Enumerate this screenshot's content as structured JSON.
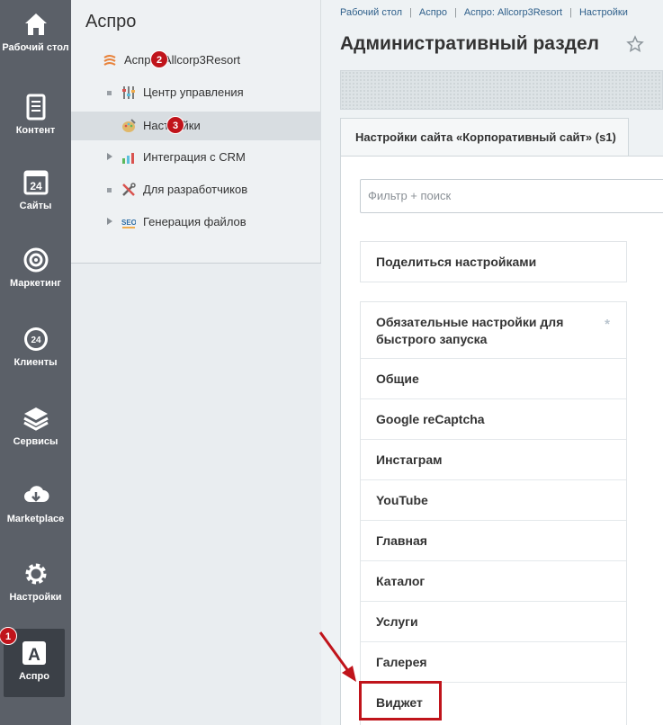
{
  "rail": {
    "items": [
      {
        "label": "Рабочий стол",
        "icon": "home-icon"
      },
      {
        "label": "Контент",
        "icon": "document-icon"
      },
      {
        "label": "Сайты",
        "icon": "calendar-24-icon"
      },
      {
        "label": "Маркетинг",
        "icon": "target-icon"
      },
      {
        "label": "Клиенты",
        "icon": "crm-24-icon"
      },
      {
        "label": "Сервисы",
        "icon": "layers-icon"
      },
      {
        "label": "Marketplace",
        "icon": "cloud-download-icon"
      },
      {
        "label": "Настройки",
        "icon": "gear-icon"
      },
      {
        "label": "Аспро",
        "icon": "letter-a-icon"
      }
    ],
    "badge": "1"
  },
  "menu": {
    "title": "Аспро",
    "items": [
      {
        "label": "Аспро: Allcorp3Resort",
        "badge": "2"
      },
      {
        "label": "Центр управления"
      },
      {
        "label": "Настройки",
        "badge": "3"
      },
      {
        "label": "Интеграция с CRM"
      },
      {
        "label": "Для разработчиков"
      },
      {
        "label": "Генерация файлов"
      }
    ]
  },
  "breadcrumb": [
    "Рабочий стол",
    "Аспро",
    "Аспро: Allcorp3Resort",
    "Настройки"
  ],
  "page_title": "Административный раздел",
  "tab_label": "Настройки сайта «Корпоративный сайт» (s1)",
  "filter_placeholder": "Фильтр + поиск",
  "share_label": "Поделиться настройками",
  "settings_rows": [
    "Обязательные настройки для быстрого запуска",
    "Общие",
    "Google reCaptcha",
    "Инстаграм",
    "YouTube",
    "Главная",
    "Каталог",
    "Услуги",
    "Галерея",
    "Виджет"
  ],
  "required_mark": "*",
  "colors": {
    "rail": "#5b6068",
    "badge": "#c0141b",
    "link": "#2e5f8a",
    "highlight": "#c0141b"
  }
}
